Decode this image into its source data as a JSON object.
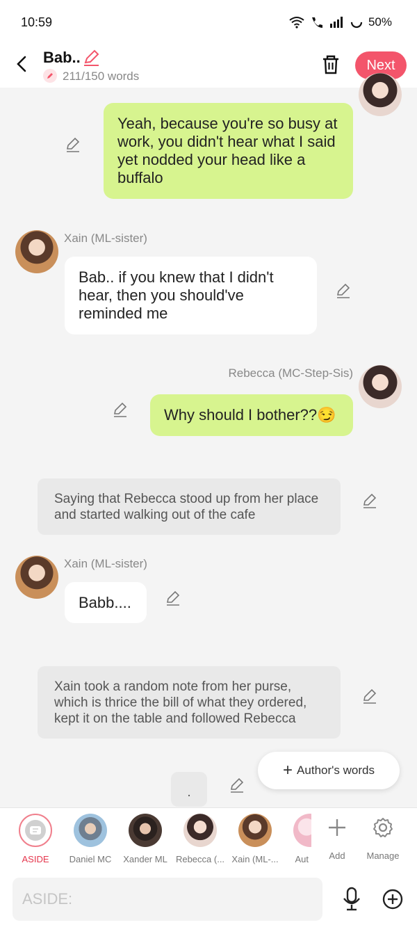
{
  "status_bar": {
    "time": "10:59",
    "battery": "50%"
  },
  "header": {
    "title": "Bab..",
    "word_count": "211/150 words",
    "next_label": "Next"
  },
  "messages": [
    {
      "type": "outgoing",
      "text": "Yeah, because you're so busy at work, you didn't hear what I said yet nodded your head like a buffalo"
    },
    {
      "type": "incoming",
      "name": "Xain (ML-sister)",
      "text": "Bab.. if you knew that I didn't hear, then you should've reminded me"
    },
    {
      "type": "outgoing",
      "name": "Rebecca (MC-Step-Sis)",
      "text": "Why should I bother??😏"
    },
    {
      "type": "aside",
      "text": "Saying that Rebecca stood up from her place and started walking out of the cafe"
    },
    {
      "type": "incoming",
      "name": "Xain (ML-sister)",
      "text": "Babb...."
    },
    {
      "type": "aside",
      "text": "Xain took a random note from her purse, which is thrice the bill of what they ordered, kept it on the table and followed Rebecca"
    },
    {
      "type": "aside",
      "text": "."
    }
  ],
  "authors_words_label": "Author's words",
  "characters": [
    {
      "label": "ASIDE"
    },
    {
      "label": "Daniel MC"
    },
    {
      "label": "Xander ML"
    },
    {
      "label": "Rebecca (..."
    },
    {
      "label": "Xain (ML-..."
    },
    {
      "label": "Aut"
    }
  ],
  "add_label": "Add",
  "manage_label": "Manage",
  "input": {
    "placeholder": "ASIDE:"
  }
}
